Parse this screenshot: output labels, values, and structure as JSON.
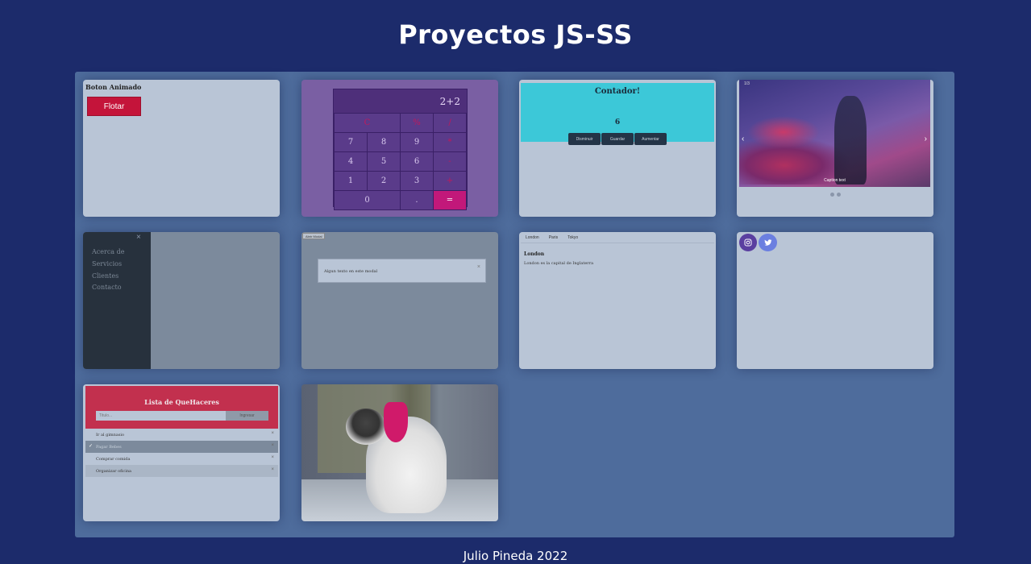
{
  "page": {
    "title": "Proyectos JS-SS",
    "footer": "Julio Pineda 2022"
  },
  "cards": {
    "boton_animado": {
      "title": "Boton Animado",
      "button": "Flotar"
    },
    "calculadora": {
      "display": "2+2",
      "keys": [
        "C",
        "%",
        "/",
        "7",
        "8",
        "9",
        "*",
        "4",
        "5",
        "6",
        "-",
        "1",
        "2",
        "3",
        "+",
        "0",
        ".",
        "="
      ]
    },
    "contador": {
      "title": "Contador!",
      "value": "6",
      "buttons": [
        "Disminuir",
        "Guardar",
        "Aumentar"
      ]
    },
    "carrusel": {
      "counter": "1/3",
      "caption": "Caption text",
      "prev": "‹",
      "next": "›",
      "dots": 2
    },
    "sidenav": {
      "close": "×",
      "items": [
        "Acerca de",
        "Servicios",
        "Clientes",
        "Contacto"
      ]
    },
    "modal": {
      "button": "Abrir Modal",
      "text": "Algun texto en este modal",
      "close": "×"
    },
    "tabs": {
      "tabs": [
        "London",
        "Paris",
        "Tokyo"
      ],
      "heading": "London",
      "text": "London es la capital de Inglaterra"
    },
    "social": {
      "icons": [
        "instagram-icon",
        "twitter-icon"
      ],
      "colors": {
        "instagram": "#5a3fa0",
        "twitter": "#6b7fe0"
      }
    },
    "lista": {
      "title": "Lista de QueHaceres",
      "placeholder": "Titulo...",
      "add": "Ingresar",
      "items": [
        {
          "text": "Ir al gimnasio",
          "checked": false
        },
        {
          "text": "Pagar Bebes",
          "checked": true
        },
        {
          "text": "Comprar comida",
          "checked": false
        },
        {
          "text": "Organizar oficina",
          "checked": false
        }
      ],
      "remove": "×",
      "check": "✓"
    }
  },
  "colors": {
    "background": "#1c2b6b",
    "panel": "#4e6c9c",
    "accent": "#c4143a"
  }
}
